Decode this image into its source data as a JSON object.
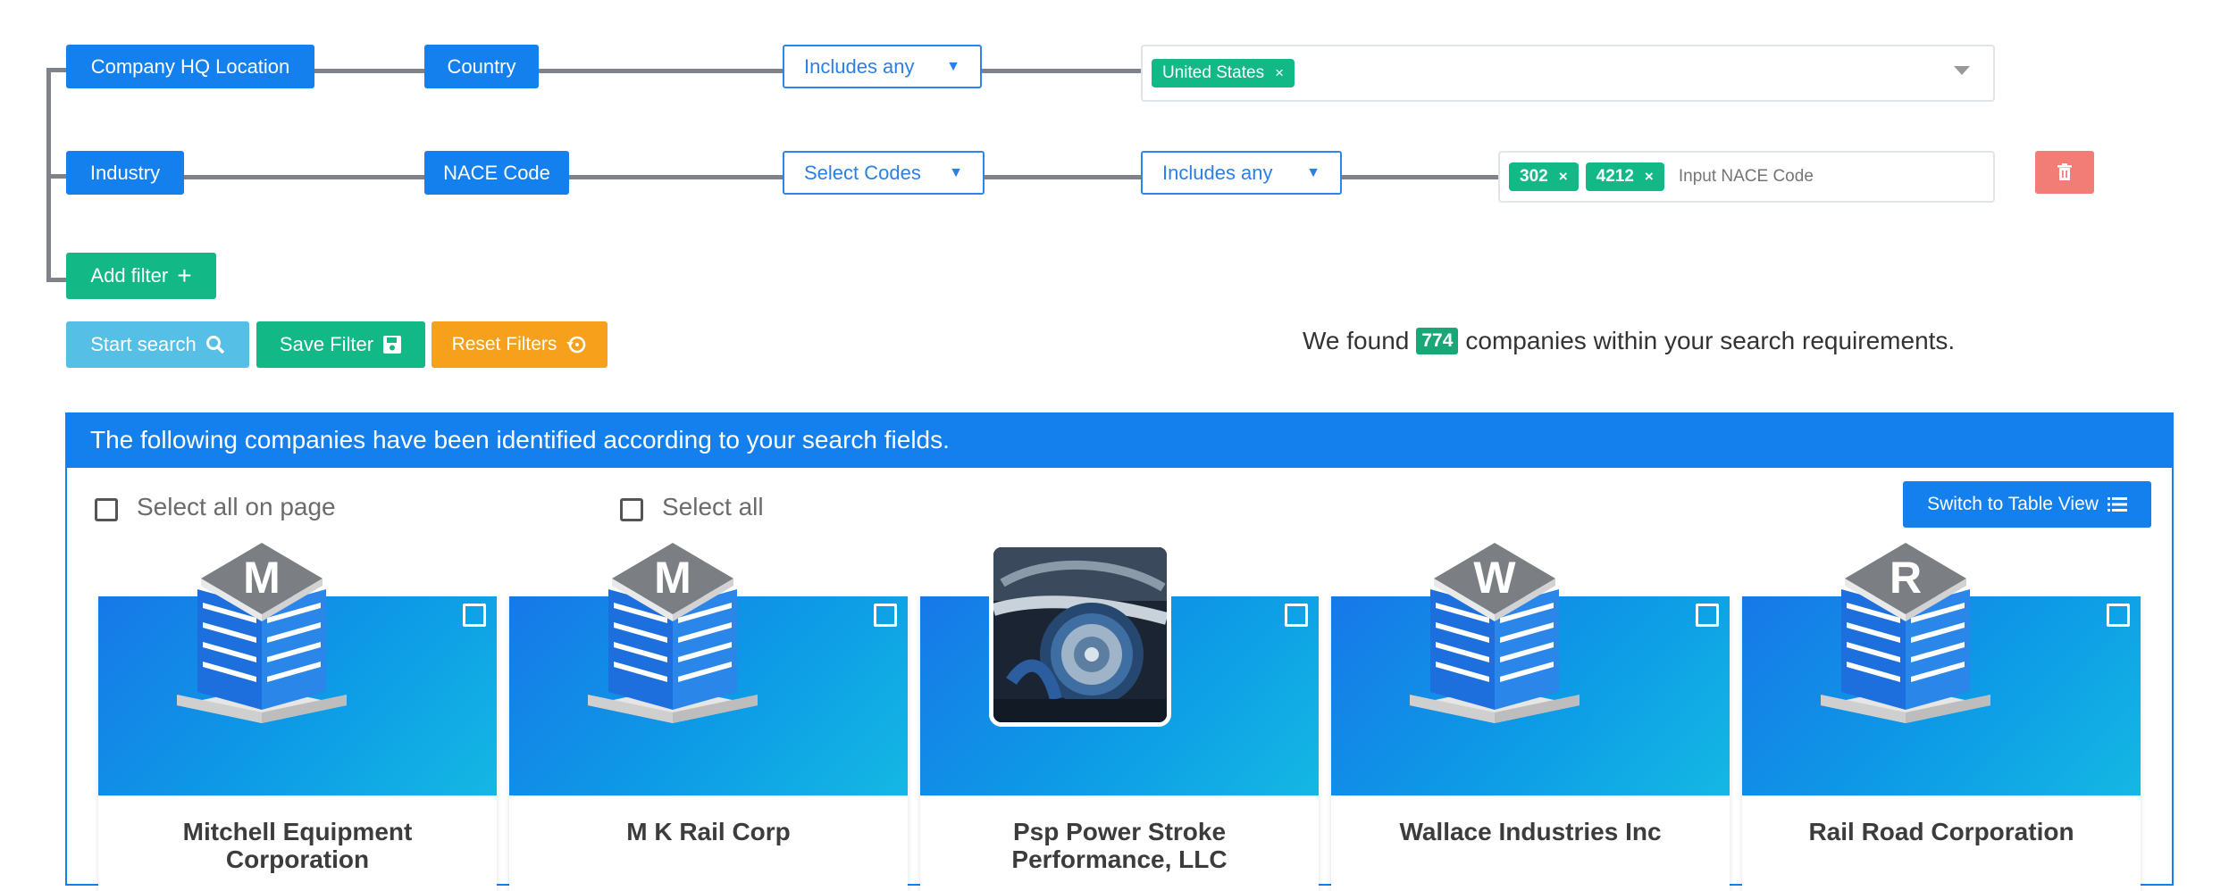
{
  "filters": {
    "row1": {
      "field": "Company HQ Location",
      "sub": "Country",
      "operator": "Includes any",
      "tags": [
        "United States"
      ]
    },
    "row2": {
      "field": "Industry",
      "sub": "NACE Code",
      "mode": "Select Codes",
      "operator": "Includes any",
      "tags": [
        "302",
        "4212"
      ],
      "placeholder": "Input NACE Code"
    },
    "add_filter": "Add filter"
  },
  "actions": {
    "start": "Start search",
    "save": "Save Filter",
    "reset": "Reset Filters"
  },
  "result": {
    "prefix": "We found",
    "count": "774",
    "suffix": "companies within your search requirements."
  },
  "panel": {
    "header": "The following companies have been identified according to your search fields.",
    "select_page": "Select all on page",
    "select_all": "Select all",
    "switch_view": "Switch to Table View"
  },
  "cards": [
    {
      "letter": "M",
      "title1": "Mitchell Equipment",
      "title2": "Corporation"
    },
    {
      "letter": "M",
      "title1": "M K Rail Corp",
      "title2": ""
    },
    {
      "letter": "",
      "title1": "Psp Power Stroke",
      "title2": "Performance, LLC"
    },
    {
      "letter": "W",
      "title1": "Wallace Industries Inc",
      "title2": ""
    },
    {
      "letter": "R",
      "title1": "Rail Road Corporation",
      "title2": ""
    }
  ],
  "colors": {
    "primary": "#1380ee",
    "green": "#12b886",
    "cyan": "#55bfe6",
    "orange": "#f7a01c",
    "danger": "#f27d76",
    "count_badge": "#1aa777"
  },
  "icons": [
    "search-icon",
    "save-icon",
    "reset-icon",
    "plus-icon",
    "trash-icon",
    "list-icon",
    "close-icon",
    "caret-down-icon"
  ]
}
